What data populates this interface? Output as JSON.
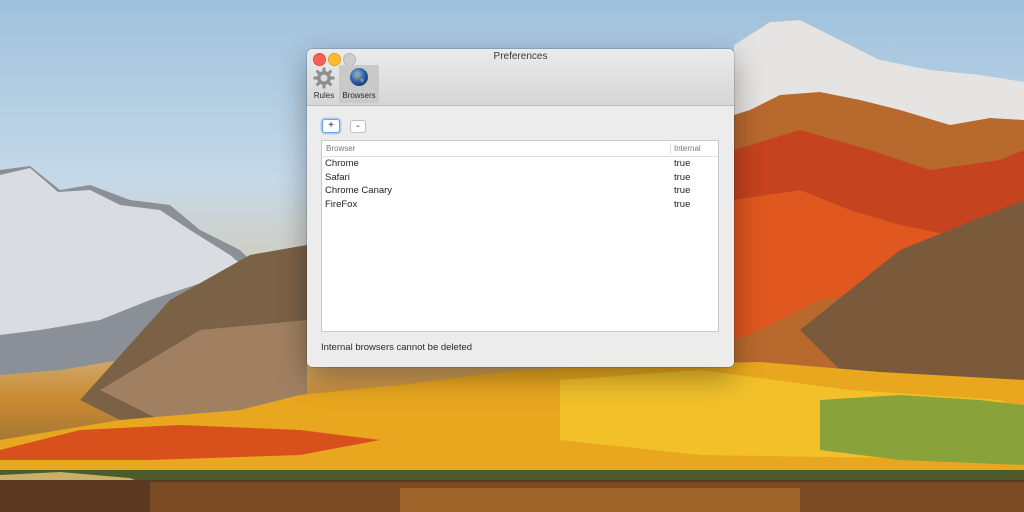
{
  "window": {
    "title": "Preferences"
  },
  "toolbar": {
    "tabs": [
      {
        "label": "Rules",
        "icon": "gear-icon"
      },
      {
        "label": "Browsers",
        "icon": "globe-icon",
        "selected": true
      }
    ]
  },
  "buttons": {
    "add_label": "+",
    "remove_label": "-"
  },
  "table": {
    "headers": [
      "Browser",
      "Internal"
    ],
    "rows": [
      {
        "browser": "Chrome",
        "internal": "true"
      },
      {
        "browser": "Safari",
        "internal": "true"
      },
      {
        "browser": "Chrome Canary",
        "internal": "true"
      },
      {
        "browser": "FireFox",
        "internal": "true"
      }
    ]
  },
  "status": "Internal browsers cannot be deleted",
  "colors": {
    "close": "#fc5f57",
    "minimize": "#fdbc2e",
    "zoom": "#cdcdcd",
    "focus": "#6aa0f3"
  }
}
